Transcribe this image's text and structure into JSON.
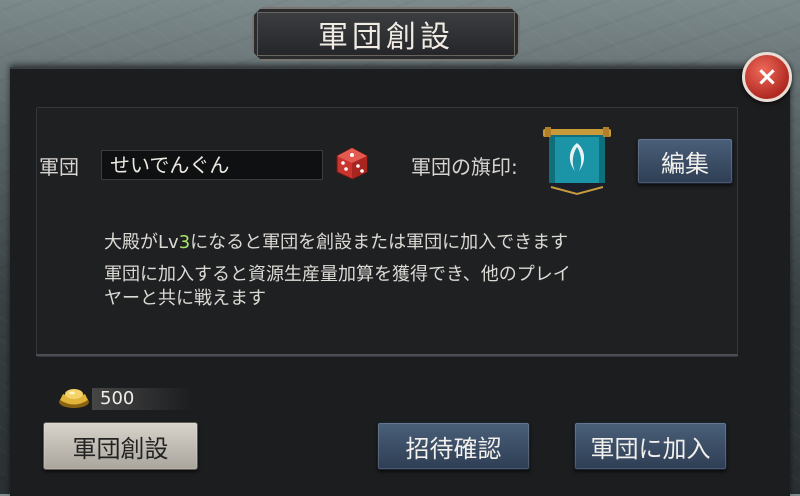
{
  "title": "軍団創設",
  "close_label": "×",
  "form": {
    "legion_label": "軍団",
    "legion_name_value": "せいでんぐん",
    "banner_label": "軍団の旗印:",
    "edit_button": "編集"
  },
  "description": {
    "line1_prefix": "大殿がLv",
    "line1_level": "3",
    "line1_suffix": "になると軍団を創設または軍団に加入できます",
    "line2": "軍団に加入すると資源生産量加算を獲得でき、他のプレイ",
    "line3": "ヤーと共に戦えます"
  },
  "cost": {
    "icon": "gold-ingot-icon",
    "amount": "500"
  },
  "buttons": {
    "create": "軍団創設",
    "invite_confirm": "招待確認",
    "join": "軍団に加入"
  },
  "colors": {
    "level_highlight": "#a8e46a",
    "close_button": "#d23c30",
    "button_blue": "#3b4e66"
  }
}
